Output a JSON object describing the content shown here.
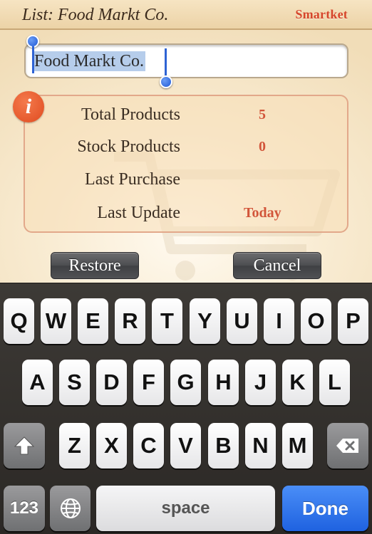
{
  "header": {
    "title": "List: Food Markt Co.",
    "logo_text": "Smartket"
  },
  "name_field": {
    "value": "Food Markt Co.",
    "selected": true
  },
  "info": {
    "icon": "info-icon",
    "icon_glyph": "i",
    "rows": [
      {
        "label": "Total Products",
        "value": "5"
      },
      {
        "label": "Stock Products",
        "value": "0"
      },
      {
        "label": "Last Purchase",
        "value": ""
      },
      {
        "label": "Last Update",
        "value": "Today"
      }
    ]
  },
  "buttons": {
    "restore_label": "Restore",
    "cancel_label": "Cancel"
  },
  "keyboard": {
    "row1": [
      "Q",
      "W",
      "E",
      "R",
      "T",
      "Y",
      "U",
      "I",
      "O",
      "P"
    ],
    "row2": [
      "A",
      "S",
      "D",
      "F",
      "G",
      "H",
      "J",
      "K",
      "L"
    ],
    "row3": [
      "Z",
      "X",
      "C",
      "V",
      "B",
      "N",
      "M"
    ],
    "numbers_label": "123",
    "space_label": "space",
    "done_label": "Done",
    "shift_icon": "shift-icon",
    "globe_icon": "globe-icon",
    "delete_icon": "delete-icon"
  },
  "colors": {
    "accent": "#d6452a",
    "done_blue": "#1f62e0",
    "selection": "#b6cdeb"
  }
}
